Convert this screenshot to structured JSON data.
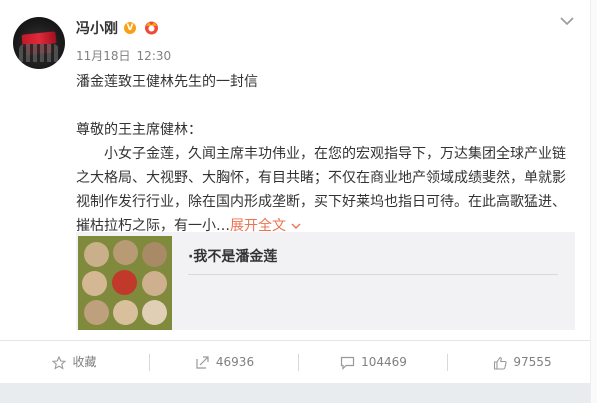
{
  "post": {
    "author": "冯小刚",
    "verified_badge": "V",
    "date": "11月18日",
    "time": "12:30",
    "title_line": "潘金莲致王健林先生的一封信",
    "greeting": "尊敬的王主席健林：",
    "body_lines": [
      "小女子金莲，久闻主席丰功伟业，在您的宏观指导下，万达集团全球产业链",
      "之大格局、大视野、大胸怀，有目共睹；不仅在商业地产领域成绩斐然，单就影",
      "视制作发行行业，除在国内形成垄断，买下好莱坞也指日可待。在此高歌猛进、",
      "摧枯拉朽之际，有一小…"
    ],
    "expand_label": "展开全文",
    "share_card_title": "·我不是潘金莲"
  },
  "actions": {
    "favorite_label": "收藏",
    "repost_count": "46936",
    "comment_count": "104469",
    "like_count": "97555"
  },
  "colors": {
    "accent": "#eb7350",
    "verified": "#f7a216",
    "muted": "#808080"
  },
  "icons": [
    "more-chevron-icon",
    "verified-icon",
    "crown-badge-icon",
    "expand-arrow-icon",
    "star-icon",
    "repost-icon",
    "comment-icon",
    "like-icon"
  ]
}
